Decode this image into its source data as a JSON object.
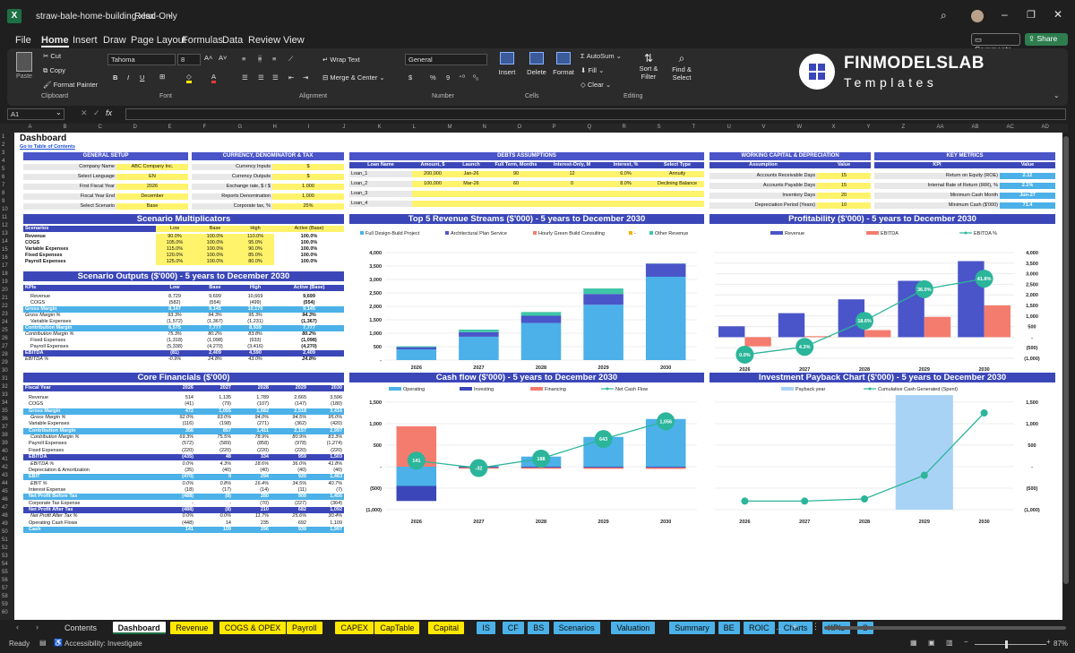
{
  "window": {
    "filename": "straw-bale-home-building.xlsx",
    "mode": "Read-Only"
  },
  "menu": [
    "File",
    "Home",
    "Insert",
    "Draw",
    "Page Layout",
    "Formulas",
    "Data",
    "Review",
    "View"
  ],
  "comments_label": "Comments",
  "share_label": "Share",
  "ribbon": {
    "clipboard": {
      "paste": "Paste",
      "cut": "Cut",
      "copy": "Copy",
      "format_painter": "Format Painter",
      "group": "Clipboard"
    },
    "font": {
      "name": "Tahoma",
      "size": "8",
      "group": "Font"
    },
    "alignment": {
      "wrap": "Wrap Text",
      "merge": "Merge & Center",
      "group": "Alignment"
    },
    "number": {
      "format": "General",
      "group": "Number"
    },
    "cells": {
      "insert": "Insert",
      "delete": "Delete",
      "format": "Format",
      "group": "Cells"
    },
    "editing": {
      "autosum": "AutoSum",
      "fill": "Fill",
      "clear": "Clear",
      "sort": "Sort & Filter",
      "find": "Find & Select",
      "group": "Editing"
    }
  },
  "brand": {
    "line1": "FINMODELSLAB",
    "line2": "Templates"
  },
  "namebox": "A1",
  "columns": [
    "A",
    "B",
    "C",
    "D",
    "E",
    "F",
    "G",
    "H",
    "I",
    "J",
    "K",
    "L",
    "M",
    "N",
    "O",
    "P",
    "Q",
    "R",
    "S",
    "T",
    "U",
    "V",
    "W",
    "X",
    "Y",
    "Z",
    "AA",
    "AB",
    "AC",
    "AD"
  ],
  "dashboard": {
    "title": "Dashboard",
    "link": "Go to Table of Contents",
    "general_setup": {
      "title": "GENERAL SETUP",
      "rows": [
        [
          "Company Name",
          "ABC Company Inc."
        ],
        [
          "Select Language",
          "EN"
        ],
        [
          "First Fiscal Year",
          "2026"
        ],
        [
          "Fiscal Year End",
          "December"
        ],
        [
          "Select Scenario",
          "Base"
        ]
      ]
    },
    "currency": {
      "title": "CURRENCY, DENOMINATOR & TAX",
      "rows": [
        [
          "Currency Inputs",
          "$"
        ],
        [
          "Currency Outputs",
          "$"
        ],
        [
          "Exchange rate, $ / $",
          "1.000"
        ],
        [
          "Reports Denomination",
          "1,000"
        ],
        [
          "Corporate tax, %",
          "25%"
        ]
      ]
    },
    "debts": {
      "title": "DEBTS ASSUMPTIONS",
      "headers": [
        "Loan Name",
        "Amount, $",
        "Launch",
        "Full Term, Months",
        "Interest-Only, M",
        "Interest, %",
        "Select Type"
      ],
      "rows": [
        [
          "Loan_1",
          "200,000",
          "Jan-26",
          "90",
          "12",
          "6.0%",
          "Annuity"
        ],
        [
          "Loan_2",
          "100,000",
          "Mar-26",
          "60",
          "0",
          "8.0%",
          "Declining Balance"
        ],
        [
          "Loan_3",
          "",
          "",
          "",
          "",
          "",
          ""
        ],
        [
          "Loan_4",
          "",
          "",
          "",
          "",
          "",
          ""
        ]
      ]
    },
    "working": {
      "title": "WORKING CAPITAL & DEPRECIATION",
      "headers": [
        "Assumption",
        "Value"
      ],
      "rows": [
        [
          "Accounts Receivable Days",
          "15"
        ],
        [
          "Accounts Payable Days",
          "15"
        ],
        [
          "Inventory Days",
          "20"
        ],
        [
          "Depreciation Period (Years)",
          "10"
        ]
      ]
    },
    "kpis": {
      "title": "KEY METRICS",
      "headers": [
        "KPI",
        "Value"
      ],
      "rows": [
        [
          "Return on Equity (ROE)",
          "2.12"
        ],
        [
          "Internal Rate of Return (IRR), %",
          "2.1%"
        ],
        [
          "Minimum Cash Month",
          "Jun-27"
        ],
        [
          "Minimum Cash ($'000)",
          "71.4"
        ]
      ]
    },
    "multipliers": {
      "title": "Scenario Multiplicators",
      "headers": [
        "Scenarios",
        "Low",
        "Base",
        "High",
        "Active (Base)"
      ],
      "rows": [
        [
          "Revenue",
          "90.0%",
          "100.0%",
          "110.0%",
          "100.0%"
        ],
        [
          "COGS",
          "105.0%",
          "100.0%",
          "95.0%",
          "100.0%"
        ],
        [
          "Variable Expenses",
          "115.0%",
          "100.0%",
          "90.0%",
          "100.0%"
        ],
        [
          "Fixed Expenses",
          "120.0%",
          "100.0%",
          "85.0%",
          "100.0%"
        ],
        [
          "Payroll Expenses",
          "125.0%",
          "100.0%",
          "80.0%",
          "100.0%"
        ]
      ]
    },
    "outputs": {
      "title": "Scenario Outputs ($'000) - 5 years to December 2030",
      "headers": [
        "KPIs",
        "Low",
        "Base",
        "High",
        "Active (Base)"
      ],
      "rows": [
        [
          "Revenue",
          "8,729",
          "9,699",
          "10,669",
          "9,699",
          "n"
        ],
        [
          "COGS",
          "(582)",
          "(554)",
          "(499)",
          "(554)",
          "n"
        ],
        [
          "Gross Margin",
          "8,147",
          "9,145",
          "10,170",
          "9,145",
          "b"
        ],
        [
          "Gross Margin %",
          "93.3%",
          "94.3%",
          "95.3%",
          "94.3%",
          "i"
        ],
        [
          "Variable Expenses",
          "(1,572)",
          "(1,367)",
          "(1,231)",
          "(1,367)",
          "n"
        ],
        [
          "Contribution Margin",
          "6,575",
          "7,777",
          "8,939",
          "7,777",
          "b"
        ],
        [
          "Contribution Margin %",
          "75.3%",
          "80.2%",
          "83.8%",
          "80.2%",
          "i"
        ],
        [
          "Fixed Expenses",
          "(1,318)",
          "(1,098)",
          "(933)",
          "(1,098)",
          "n"
        ],
        [
          "Payroll Expenses",
          "(5,338)",
          "(4,270)",
          "(3,416)",
          "(4,270)",
          "n"
        ],
        [
          "EBITDA",
          "(81)",
          "2,409",
          "4,590",
          "2,409",
          "d"
        ],
        [
          "EBITDA %",
          "-0.9%",
          "24.8%",
          "43.0%",
          "24.8%",
          "i"
        ]
      ]
    },
    "core": {
      "title": "Core Financials ($'000)",
      "headers": [
        "Fiscal Year",
        "2026",
        "2027",
        "2028",
        "2029",
        "2030"
      ],
      "rows": [
        [
          "Revenue",
          "514",
          "1,135",
          "1,789",
          "2,665",
          "3,596",
          "n"
        ],
        [
          "COGS",
          "(41)",
          "(79)",
          "(107)",
          "(147)",
          "(180)",
          "n"
        ],
        [
          "Gross Margin",
          "472",
          "1,055",
          "1,682",
          "2,518",
          "3,416",
          "b"
        ],
        [
          "Gross Margin %",
          "92.0%",
          "93.0%",
          "94.0%",
          "94.5%",
          "95.0%",
          "i"
        ],
        [
          "Variable Expenses",
          "(116)",
          "(198)",
          "(271)",
          "(362)",
          "(420)",
          "n"
        ],
        [
          "Contribution Margin",
          "356",
          "857",
          "1,411",
          "2,157",
          "2,997",
          "b"
        ],
        [
          "Contribution Margin %",
          "69.3%",
          "75.5%",
          "78.9%",
          "80.9%",
          "83.3%",
          "i"
        ],
        [
          "Payroll Expenses",
          "(572)",
          "(589)",
          "(858)",
          "(978)",
          "(1,274)",
          "n"
        ],
        [
          "Fixed Expenses",
          "(220)",
          "(220)",
          "(220)",
          "(220)",
          "(220)",
          "n"
        ],
        [
          "EBITDA",
          "(435)",
          "48",
          "334",
          "959",
          "1,503",
          "d"
        ],
        [
          "EBITDA %",
          "0.0%",
          "4.3%",
          "18.6%",
          "36.0%",
          "41.8%",
          "i"
        ],
        [
          "Depreciation & Amortization",
          "(35)",
          "(40)",
          "(40)",
          "(40)",
          "(40)",
          "n"
        ],
        [
          "EBIT",
          "(470)",
          "9",
          "294",
          "920",
          "1,463",
          "b"
        ],
        [
          "EBIT %",
          "0.0%",
          "0.8%",
          "16.4%",
          "34.5%",
          "40.7%",
          "i"
        ],
        [
          "Interest Expense",
          "(18)",
          "(17)",
          "(14)",
          "(11)",
          "(7)",
          "n"
        ],
        [
          "Net Profit Before Tax",
          "(488)",
          "(8)",
          "280",
          "909",
          "1,456",
          "b"
        ],
        [
          "Corporate Tax Expense",
          "-",
          "-",
          "(70)",
          "(227)",
          "(364)",
          "n"
        ],
        [
          "Net Profit After Tax",
          "(488)",
          "(8)",
          "210",
          "682",
          "1,092",
          "d"
        ],
        [
          "Net Profit After Tax %",
          "0.0%",
          "0.0%",
          "11.7%",
          "25.6%",
          "30.4%",
          "i"
        ],
        [
          "Operating Cash Flows",
          "(448)",
          "14",
          "235",
          "692",
          "1,109",
          "n"
        ],
        [
          "Cash",
          "141",
          "109",
          "296",
          "939",
          "1,997",
          "b"
        ]
      ]
    }
  },
  "chart_data": [
    {
      "type": "bar",
      "title": "Top 5 Revenue Streams ($'000) - 5 years to December 2030",
      "categories": [
        "2026",
        "2027",
        "2028",
        "2029",
        "2030"
      ],
      "series": [
        {
          "name": "Full Design-Build Project",
          "values": [
            400,
            870,
            1380,
            2060,
            3100
          ],
          "color": "#4bb1e8"
        },
        {
          "name": "Architectural Plan Service",
          "values": [
            80,
            170,
            270,
            400,
            490
          ],
          "color": "#4a55c9"
        },
        {
          "name": "Hourly Green Build Consulting",
          "values": [
            0,
            0,
            0,
            0,
            0
          ],
          "color": "#f47c6e"
        },
        {
          "name": "-",
          "values": [
            0,
            0,
            0,
            0,
            0
          ],
          "color": "#f5b400"
        },
        {
          "name": "Other Revenue",
          "values": [
            34,
            95,
            139,
            205,
            6
          ],
          "color": "#3ec6a8"
        }
      ],
      "ylim": [
        0,
        4000
      ],
      "yticks": [
        "-",
        "500",
        "1,000",
        "1,500",
        "2,000",
        "2,500",
        "3,000",
        "3,500",
        "4,000"
      ]
    },
    {
      "type": "bar+line",
      "title": "Profitability ($'000) - 5 years to December 2030",
      "categories": [
        "2026",
        "2027",
        "2028",
        "2029",
        "2030"
      ],
      "series": [
        {
          "name": "Revenue",
          "values": [
            514,
            1135,
            1789,
            2665,
            3596
          ],
          "color": "#4a55c9"
        },
        {
          "name": "EBITDA",
          "values": [
            -435,
            48,
            334,
            959,
            1503
          ],
          "color": "#f47c6e"
        },
        {
          "name": "EBITDA %",
          "values": [
            0.0,
            4.3,
            18.6,
            36.0,
            41.8
          ],
          "labels": [
            "0.0%",
            "4.3%",
            "18.6%",
            "36.0%",
            "41.8%"
          ],
          "color": "#2bb59a"
        }
      ],
      "ylim": [
        -1000,
        4000
      ],
      "yticks": [
        "(1,000)",
        "(500)",
        "-",
        "500",
        "1,000",
        "1,500",
        "2,000",
        "2,500",
        "3,000",
        "3,500",
        "4,000"
      ]
    },
    {
      "type": "bar+line",
      "title": "Cash flow ($'000) - 5 years to December 2030",
      "categories": [
        "2026",
        "2027",
        "2028",
        "2029",
        "2030"
      ],
      "series": [
        {
          "name": "Operating",
          "values": [
            -448,
            14,
            235,
            692,
            1109
          ],
          "color": "#4bb1e8"
        },
        {
          "name": "Investing",
          "values": [
            -350,
            -20,
            -20,
            -20,
            -20
          ],
          "color": "#3b47b8"
        },
        {
          "name": "Financing",
          "values": [
            939,
            -26,
            -28,
            -31,
            -33
          ],
          "color": "#f47c6e"
        },
        {
          "name": "Net Cash Flow",
          "values": [
            141,
            -32,
            188,
            643,
            1056
          ],
          "labels": [
            "141",
            "-32",
            "188",
            "643",
            "1,056"
          ],
          "color": "#2bb59a"
        }
      ],
      "ylim": [
        -1000,
        1500
      ],
      "yticks": [
        "(1,000)",
        "(500)",
        "-",
        "500",
        "1,000",
        "1,500"
      ]
    },
    {
      "type": "line",
      "title": "Investment Payback Chart ($'000) - 5 years to December 2030",
      "categories": [
        "2026",
        "2027",
        "2028",
        "2029",
        "2030"
      ],
      "series": [
        {
          "name": "Payback year",
          "values": [
            0,
            0,
            0,
            1,
            0
          ],
          "color": "#a9d3f5"
        },
        {
          "name": "Cumulative Cash Generated (Spent)",
          "values": [
            -800,
            -800,
            -750,
            -200,
            1250
          ],
          "color": "#2bb59a"
        }
      ],
      "ylim": [
        -1000,
        1500
      ],
      "yticks": [
        "(1,000)",
        "(500)",
        "-",
        "500",
        "1,000",
        "1,500"
      ]
    }
  ],
  "sheet_tabs": [
    {
      "label": "Contents",
      "c": "n"
    },
    {
      "label": "Dashboard",
      "c": "a"
    },
    {
      "label": "Revenue",
      "c": "y"
    },
    {
      "label": "COGS & OPEX",
      "c": "y"
    },
    {
      "label": "Payroll",
      "c": "y"
    },
    {
      "label": "CAPEX",
      "c": "y"
    },
    {
      "label": "CapTable",
      "c": "y"
    },
    {
      "label": "Capital",
      "c": "y"
    },
    {
      "label": "IS",
      "c": "b"
    },
    {
      "label": "CF",
      "c": "b"
    },
    {
      "label": "BS",
      "c": "b"
    },
    {
      "label": "Scenarios",
      "c": "b"
    },
    {
      "label": "Valuation",
      "c": "b"
    },
    {
      "label": "Summary",
      "c": "b"
    },
    {
      "label": "BE",
      "c": "b"
    },
    {
      "label": "ROIC",
      "c": "b"
    },
    {
      "label": "Charts",
      "c": "b"
    },
    {
      "label": "KPIs",
      "c": "b"
    },
    {
      "label": "S",
      "c": "b"
    }
  ],
  "status": {
    "ready": "Ready",
    "accessibility": "Accessibility: Investigate",
    "zoom": "87%"
  }
}
